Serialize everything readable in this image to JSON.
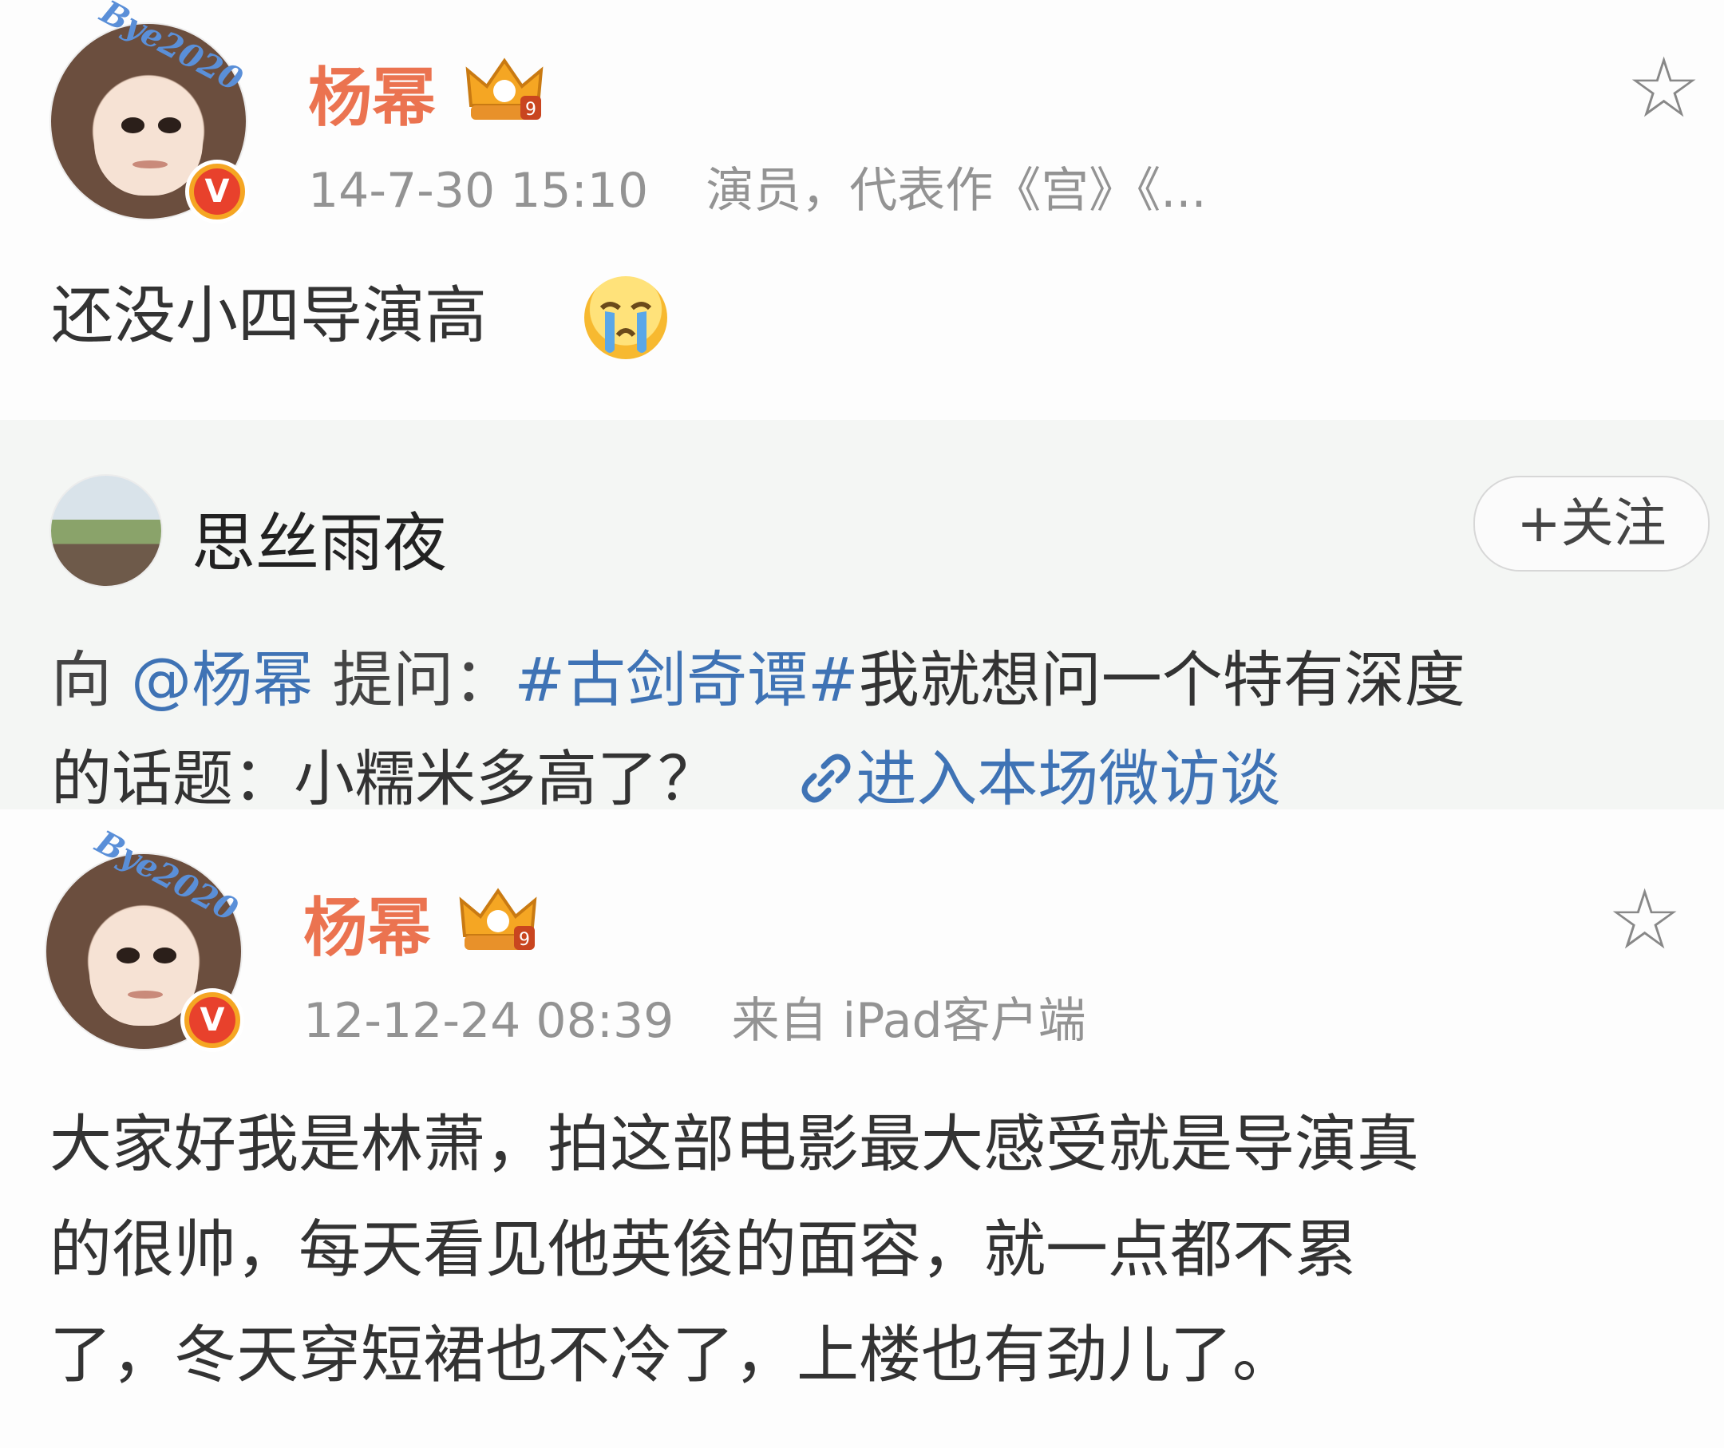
{
  "posts": [
    {
      "avatar_stamp": "Bye2020",
      "author": "杨幂",
      "timestamp": "14-7-30 15:10",
      "source": "演员，代表作《宫》《...",
      "content": "还没小四导演高",
      "emoji": "crying-face-icon",
      "level_badge": "9",
      "verified_badge": "V"
    },
    {
      "avatar_stamp": "Bye2020",
      "author": "杨幂",
      "timestamp": "12-12-24 08:39",
      "source": "来自 iPad客户端",
      "content_lines": [
        "大家好我是林萧，拍这部电影最大感受就是导演真",
        "的很帅，每天看见他英俊的面容，就一点都不累",
        "了，冬天穿短裙也不冷了，上楼也有劲儿了。"
      ],
      "level_badge": "9",
      "verified_badge": "V"
    }
  ],
  "quoted": {
    "user": "思丝雨夜",
    "follow_label": "+关注",
    "prefix": "向",
    "mention": "@杨幂",
    "ask_label": "提问：",
    "topic": "#古剑奇谭#",
    "question_line1": "我就想问一个特有深度",
    "question_line2": "的话题：小糯米多高了？",
    "link_label": "进入本场微访谈",
    "link_icon": "link-icon"
  },
  "colors": {
    "author_name": "#eb7350",
    "link_blue": "#3f73b5",
    "meta_gray": "#939393",
    "quote_bg": "#f4f6f4",
    "verified_red": "#e8412c",
    "crown_gold": "#f5a623"
  },
  "icons": {
    "favorite": "star-outline-icon",
    "crown": "crown-badge-icon"
  }
}
